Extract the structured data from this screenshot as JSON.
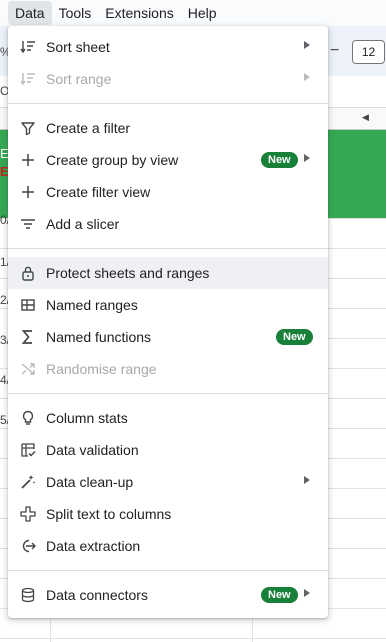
{
  "menubar": {
    "items": [
      {
        "label": "Data",
        "active": true
      },
      {
        "label": "Tools",
        "active": false
      },
      {
        "label": "Extensions",
        "active": false
      },
      {
        "label": "Help",
        "active": false
      }
    ]
  },
  "background": {
    "toolbar": {
      "font_size": "12",
      "minus": "−"
    },
    "left_peeks": {
      "toolbar": "%",
      "formula": "OI"
    },
    "header_letters": [
      "E",
      "E"
    ],
    "row_peeks": [
      "0/",
      "1/",
      "2/",
      "3/",
      "4/",
      "5/"
    ]
  },
  "menu": {
    "groups": [
      [
        {
          "label": "Sort sheet",
          "icon": "sort-icon",
          "submenu": true,
          "disabled": false
        },
        {
          "label": "Sort range",
          "icon": "sort-icon",
          "submenu": true,
          "disabled": true
        }
      ],
      [
        {
          "label": "Create a filter",
          "icon": "filter-icon",
          "submenu": false,
          "disabled": false
        },
        {
          "label": "Create group by view",
          "icon": "plus-icon",
          "submenu": true,
          "disabled": false,
          "badge": "New"
        },
        {
          "label": "Create filter view",
          "icon": "plus-icon",
          "submenu": false,
          "disabled": false
        },
        {
          "label": "Add a slicer",
          "icon": "slicer-icon",
          "submenu": false,
          "disabled": false
        }
      ],
      [
        {
          "label": "Protect sheets and ranges",
          "icon": "lock-icon",
          "submenu": false,
          "disabled": false,
          "hover": true
        },
        {
          "label": "Named ranges",
          "icon": "table-icon",
          "submenu": false,
          "disabled": false
        },
        {
          "label": "Named functions",
          "icon": "sigma-icon",
          "submenu": false,
          "disabled": false,
          "badge": "New"
        },
        {
          "label": "Randomise range",
          "icon": "shuffle-icon",
          "submenu": false,
          "disabled": true
        }
      ],
      [
        {
          "label": "Column stats",
          "icon": "lightbulb-icon",
          "submenu": false,
          "disabled": false
        },
        {
          "label": "Data validation",
          "icon": "validation-icon",
          "submenu": false,
          "disabled": false
        },
        {
          "label": "Data clean-up",
          "icon": "wand-icon",
          "submenu": true,
          "disabled": false
        },
        {
          "label": "Split text to columns",
          "icon": "split-icon",
          "submenu": false,
          "disabled": false
        },
        {
          "label": "Data extraction",
          "icon": "extraction-icon",
          "submenu": false,
          "disabled": false
        }
      ],
      [
        {
          "label": "Data connectors",
          "icon": "database-icon",
          "submenu": true,
          "disabled": false,
          "badge": "New"
        }
      ]
    ]
  },
  "colors": {
    "badge_green": "#188038",
    "header_green": "#34a853",
    "hover_bg": "#eef0f3"
  }
}
